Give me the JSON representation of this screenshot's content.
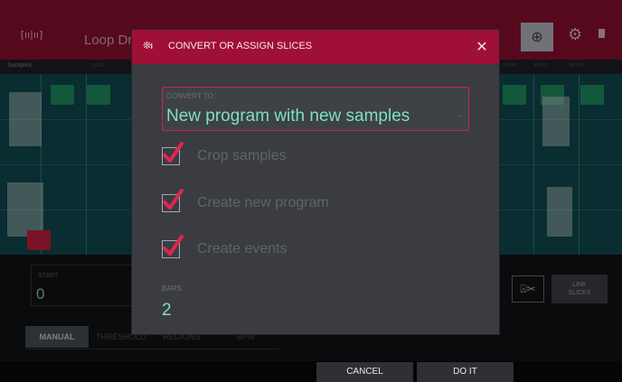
{
  "app": {
    "title": "Loop Dru",
    "timeline_label": "Samples",
    "timeline_marks": [
      "1:000",
      "1:4:000",
      "5:000",
      "8:000",
      "9:000"
    ],
    "start_label": "START",
    "start_value": "0",
    "tabs": [
      {
        "label": "MANUAL"
      },
      {
        "label": "THRESHOLD"
      },
      {
        "label": "REGIONS"
      },
      {
        "label": "BPM"
      }
    ],
    "link_slices_label": "LINK\nSLICES"
  },
  "dialog": {
    "title": "CONVERT OR ASSIGN SLICES",
    "icon": "slice-icon",
    "convert_to": {
      "label": "CONVERT TO",
      "value": "New program with new samples"
    },
    "checkboxes": [
      {
        "label": "Crop samples",
        "checked": true
      },
      {
        "label": "Create new program",
        "checked": true
      },
      {
        "label": "Create events",
        "checked": true
      }
    ],
    "bars": {
      "label": "BARS",
      "value": "2"
    }
  },
  "footer": {
    "cancel_label": "CANCEL",
    "doit_label": "DO IT"
  },
  "colors": {
    "accent": "#a00f35",
    "value_text": "#7fe0c1",
    "check_red": "#e0264f"
  }
}
